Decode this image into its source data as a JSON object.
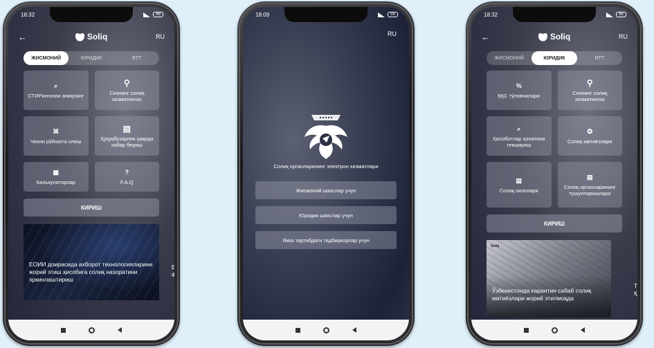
{
  "phones": [
    {
      "time": "18:32",
      "battery": "46",
      "logo_text": "Soliq",
      "lang": "RU",
      "tabs": [
        "ЖИСМОНИЙ",
        "ЮРИДИК",
        "ЯТТ"
      ],
      "active_tab": 0,
      "tiles": [
        {
          "icon": "search-icon",
          "glyph": "⌕",
          "label": "СТИРингизни аниқланг"
        },
        {
          "icon": "location-pin-icon",
          "glyph": "⚲",
          "label": "Сизнинг солиқ хизматингиз"
        },
        {
          "icon": "receipt-icon",
          "glyph": "⌘",
          "label": "Чекни рўйхатга олиш"
        },
        {
          "icon": "report-document-icon",
          "glyph": "▤",
          "label": "Ҳуқуқбузарлик ҳақида хабар бериш"
        },
        {
          "icon": "calculator-icon",
          "glyph": "▦",
          "label": "Калькуляторлар"
        },
        {
          "icon": "question-icon",
          "glyph": "?",
          "label": "F.A.Q"
        }
      ],
      "login_label": "КИРИШ",
      "news_text": "ЕОИИ доирасида ахборот технологияларини жорий этиш ҳисобига солиқ назоратини эркинлаштириш",
      "news_peek": "Е\nФ"
    },
    {
      "time": "18:09",
      "battery": "56",
      "lang": "RU",
      "title": "Солиқ органларининг электрон хизматлари",
      "buttons": [
        "Жисмоний шахслар учун",
        "Юридик шахслар учун",
        "Якка тартибдаги тадбиркорлар учун"
      ]
    },
    {
      "time": "18:32",
      "battery": "46",
      "logo_text": "Soliq",
      "lang": "RU",
      "tabs": [
        "ЖИСМОНИЙ",
        "ЮРИДИК",
        "ЯТТ"
      ],
      "active_tab": 1,
      "tiles": [
        {
          "icon": "percent-icon",
          "glyph": "%",
          "label": "ҚҚС тўловчилари"
        },
        {
          "icon": "location-pin-icon",
          "glyph": "⚲",
          "label": "Сизнинг солиқ хизматингиз"
        },
        {
          "icon": "search-icon",
          "glyph": "⌕",
          "label": "Ҳисоботлар ҳолатини текшириш"
        },
        {
          "icon": "badge-icon",
          "glyph": "✪",
          "label": "Солиқ имтиёзлари"
        },
        {
          "icon": "document-icon",
          "glyph": "▤",
          "label": "Солиқ низолари"
        },
        {
          "icon": "document-icon",
          "glyph": "▤",
          "label": "Солиқ органларининг тушунтиришлари"
        }
      ],
      "login_label": "КИРИШ",
      "news_brand": "Soliq",
      "news_text": "Ўзбекистонда карантин сабаб солиқ имтиёзлари жорий этилмоқда",
      "news_peek": "Т\nҚ"
    }
  ]
}
